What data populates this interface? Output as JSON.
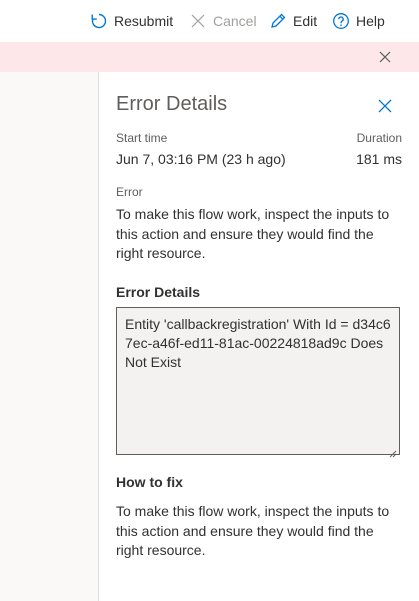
{
  "toolbar": {
    "resubmit_label": "Resubmit",
    "cancel_label": "Cancel",
    "edit_label": "Edit",
    "help_label": "Help"
  },
  "panel": {
    "title": "Error Details",
    "start_time_label": "Start time",
    "start_time_value": "Jun 7, 03:16 PM (23 h ago)",
    "duration_label": "Duration",
    "duration_value": "181 ms",
    "error_label": "Error",
    "error_message": "To make this flow work, inspect the inputs to this action and ensure they would find the right resource.",
    "details_heading": "Error Details",
    "details_text": "Entity 'callbackregistration' With Id = d34c67ec-a46f-ed11-81ac-00224818ad9c Does Not Exist",
    "how_to_fix_heading": "How to fix",
    "how_to_fix_message": "To make this flow work, inspect the inputs to this action and ensure they would find the right resource."
  },
  "colors": {
    "accent": "#0078d4",
    "banner_bg": "#fde7e9",
    "details_box_bg": "#f3f2f1"
  },
  "icons": {
    "resubmit": "resubmit-icon",
    "cancel": "cancel-icon",
    "edit": "pencil-icon",
    "help": "help-icon",
    "close": "close-icon"
  }
}
